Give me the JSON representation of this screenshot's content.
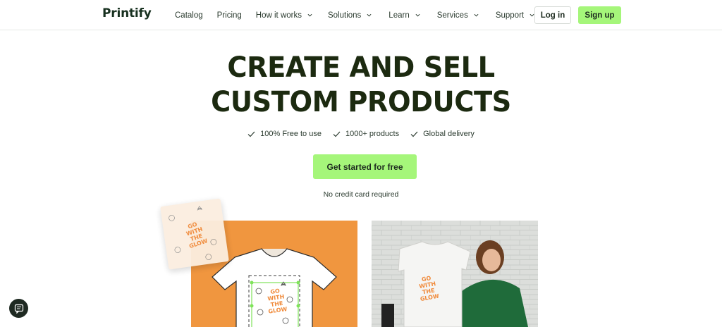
{
  "brand": {
    "logo_text": "Printify",
    "accent": "#a5f67a",
    "dark": "#1c2a10"
  },
  "nav": {
    "items": [
      {
        "label": "Catalog",
        "has_dropdown": false
      },
      {
        "label": "Pricing",
        "has_dropdown": false
      },
      {
        "label": "How it works",
        "has_dropdown": true
      },
      {
        "label": "Solutions",
        "has_dropdown": true
      },
      {
        "label": "Learn",
        "has_dropdown": true
      },
      {
        "label": "Services",
        "has_dropdown": true
      },
      {
        "label": "Support",
        "has_dropdown": true
      }
    ],
    "login_label": "Log in",
    "signup_label": "Sign up"
  },
  "hero": {
    "title_line1": "CREATE AND SELL",
    "title_line2": "CUSTOM PRODUCTS",
    "features": [
      "100% Free to use",
      "1000+ products",
      "Global delivery"
    ],
    "cta_label": "Get started for free",
    "note": "No credit card required"
  },
  "products": {
    "shirt_print_text": "GO WITH THE GLOW",
    "orange_color": "#f0963f"
  },
  "chat": {
    "icon": "chat-icon"
  }
}
